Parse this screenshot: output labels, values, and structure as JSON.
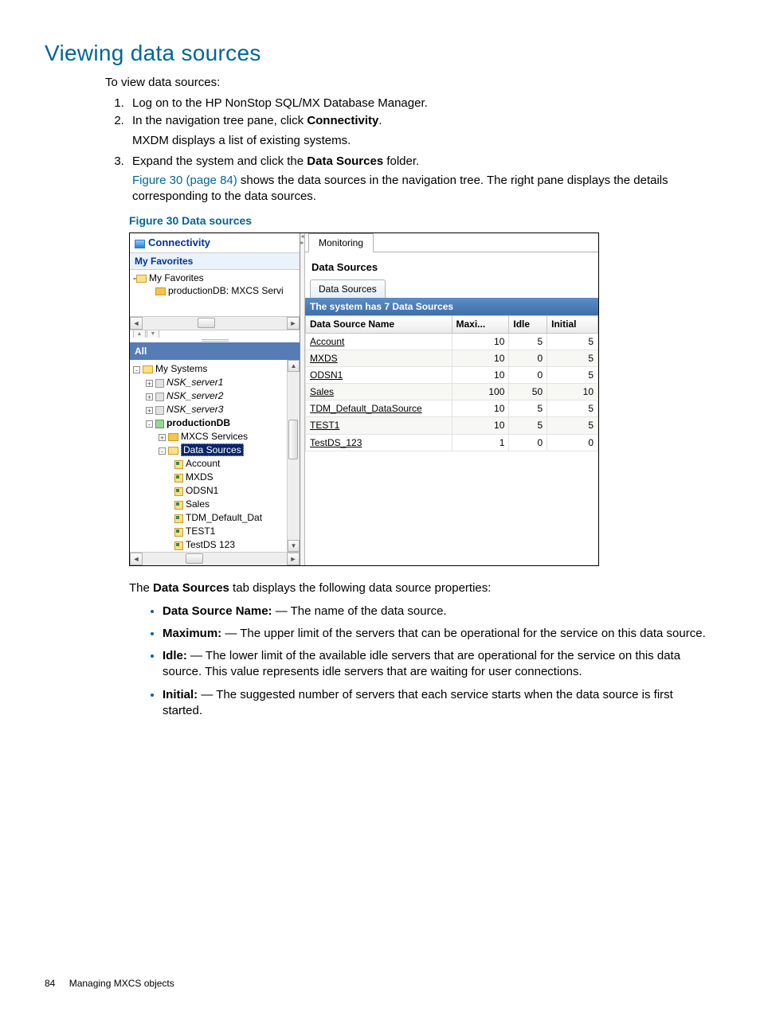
{
  "title": "Viewing data sources",
  "intro": "To view data sources:",
  "steps": {
    "1": "Log on to the HP NonStop SQL/MX Database Manager.",
    "2_prefix": "In the navigation tree pane, click ",
    "2_bold": "Connectivity",
    "2_suffix": ".",
    "2_sub": "MXDM displays a list of existing systems.",
    "3_prefix": "Expand the system and click the ",
    "3_bold": "Data Sources",
    "3_suffix": " folder.",
    "3_link": "Figure 30 (page 84)",
    "3_rest": " shows the data sources in the navigation tree. The right pane displays the details corresponding to the data sources."
  },
  "figure_caption": "Figure 30 Data sources",
  "left": {
    "section_title": "Connectivity",
    "fav_header": "My Favorites",
    "fav_root": "My Favorites",
    "fav_child": "productionDB: MXCS Servi",
    "all_header": "All",
    "root": "My Systems",
    "servers": [
      "NSK_server1",
      "NSK_server2",
      "NSK_server3"
    ],
    "prod": "productionDB",
    "mxcs": "MXCS Services",
    "ds_folder": "Data Sources",
    "ds_items": [
      "Account",
      "MXDS",
      "ODSN1",
      "Sales",
      "TDM_Default_Dat",
      "TEST1",
      "TestDS 123"
    ]
  },
  "right": {
    "tab": "Monitoring",
    "heading": "Data Sources",
    "inner_tab": "Data Sources",
    "count_bar": "The system has 7 Data Sources",
    "cols": {
      "name": "Data Source Name",
      "maxi": "Maxi...",
      "idle": "Idle",
      "initial": "Initial"
    },
    "rows": [
      {
        "name": "Account",
        "maxi": "10",
        "idle": "5",
        "initial": "5"
      },
      {
        "name": "MXDS",
        "maxi": "10",
        "idle": "0",
        "initial": "5"
      },
      {
        "name": "ODSN1",
        "maxi": "10",
        "idle": "0",
        "initial": "5"
      },
      {
        "name": "Sales",
        "maxi": "100",
        "idle": "50",
        "initial": "10"
      },
      {
        "name": "TDM_Default_DataSource",
        "maxi": "10",
        "idle": "5",
        "initial": "5"
      },
      {
        "name": "TEST1",
        "maxi": "10",
        "idle": "5",
        "initial": "5"
      },
      {
        "name": "TestDS_123",
        "maxi": "1",
        "idle": "0",
        "initial": "0"
      }
    ]
  },
  "after_prefix": "The ",
  "after_bold": "Data Sources",
  "after_suffix": " tab displays the following data source properties:",
  "props": [
    {
      "term": "Data Source Name:",
      "desc": " — The name of the data source."
    },
    {
      "term": "Maximum:",
      "desc": " — The upper limit of the servers that can be operational for the service on this data source."
    },
    {
      "term": "Idle:",
      "desc": " — The lower limit of the available idle servers that are operational for the service on this data source. This value represents idle servers that are waiting for user connections."
    },
    {
      "term": "Initial:",
      "desc": " — The suggested number of servers that each service starts when the data source is first started."
    }
  ],
  "footer": {
    "page": "84",
    "section": "Managing MXCS objects"
  }
}
